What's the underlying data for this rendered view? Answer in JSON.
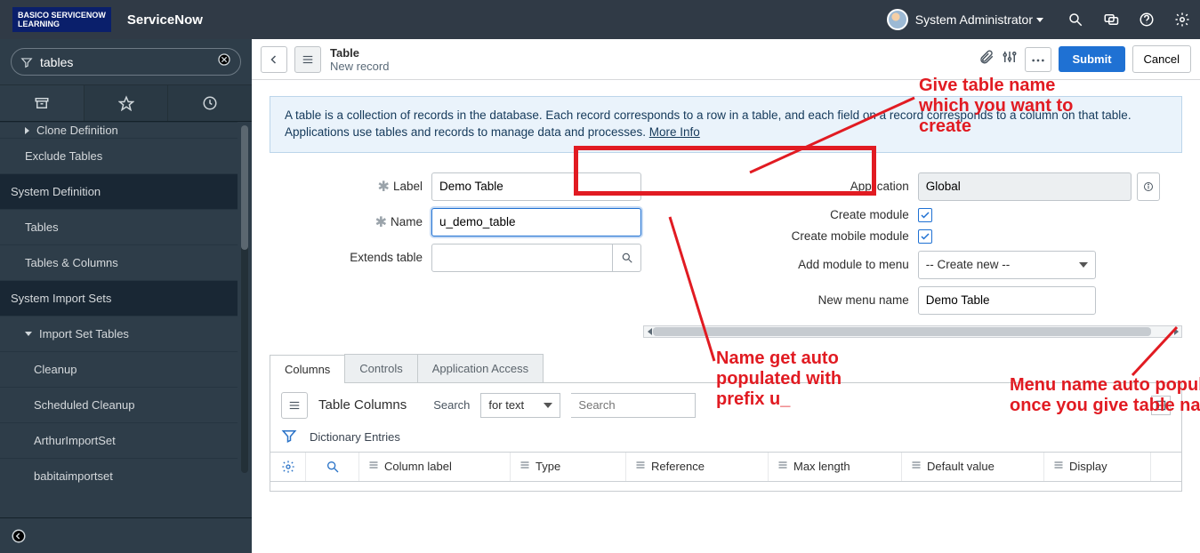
{
  "banner": {
    "logo_line1": "BASICO SERVICENOW",
    "logo_line2": "LEARNING",
    "brand": "ServiceNow",
    "user": "System Administrator"
  },
  "nav": {
    "filter_value": "tables",
    "rows": [
      {
        "label": "Clone Definition",
        "level": 1,
        "arrow": "side",
        "sel": false,
        "cut": true
      },
      {
        "label": "Exclude Tables",
        "level": 1,
        "arrow": "",
        "sel": false
      },
      {
        "label": "System Definition",
        "level": 0,
        "arrow": "",
        "sel": true
      },
      {
        "label": "Tables",
        "level": 1,
        "arrow": "",
        "sel": false
      },
      {
        "label": "Tables & Columns",
        "level": 1,
        "arrow": "",
        "sel": false
      },
      {
        "label": "System Import Sets",
        "level": 0,
        "arrow": "",
        "sel": true
      },
      {
        "label": "Import Set Tables",
        "level": 1,
        "arrow": "down",
        "sel": false
      },
      {
        "label": "Cleanup",
        "level": 2,
        "arrow": "",
        "sel": false
      },
      {
        "label": "Scheduled Cleanup",
        "level": 2,
        "arrow": "",
        "sel": false
      },
      {
        "label": "ArthurImportSet",
        "level": 2,
        "arrow": "",
        "sel": false
      },
      {
        "label": "babitaimportset",
        "level": 2,
        "arrow": "",
        "sel": false
      }
    ]
  },
  "form": {
    "title": "Table",
    "subtitle": "New record",
    "info": {
      "prefix": "A table is a collection of records in the database. Each record corresponds to a row in a table, and each field on a record corresponds to a column on that table. Applications use tables and records to manage data and processes. ",
      "link": "More Info"
    },
    "left": {
      "label_label": "Label",
      "label_value": "Demo Table",
      "name_label": "Name",
      "name_value": "u_demo_table",
      "extends_label": "Extends table",
      "extends_value": ""
    },
    "right": {
      "application_label": "Application",
      "application_value": "Global",
      "create_module_label": "Create module",
      "create_mobile_label": "Create mobile module",
      "add_menu_label": "Add module to menu",
      "add_menu_value": "-- Create new --",
      "new_menu_label": "New menu name",
      "new_menu_value": "Demo Table"
    },
    "buttons": {
      "submit": "Submit",
      "cancel": "Cancel"
    }
  },
  "tabs": [
    {
      "label": "Columns",
      "active": true
    },
    {
      "label": "Controls",
      "active": false
    },
    {
      "label": "Application Access",
      "active": false
    }
  ],
  "list": {
    "title": "Table Columns",
    "search_label": "Search",
    "search_mode": "for text",
    "search_placeholder": "Search",
    "filter_title": "Dictionary Entries",
    "columns": [
      "Column label",
      "Type",
      "Reference",
      "Max length",
      "Default value",
      "Display"
    ]
  },
  "annotations": {
    "a1": "Give table name\nwhich you want to\ncreate",
    "a2": "Name get auto\npopulated with\nprefix u_",
    "a3": "Menu name auto populated\nonce you give table name"
  }
}
